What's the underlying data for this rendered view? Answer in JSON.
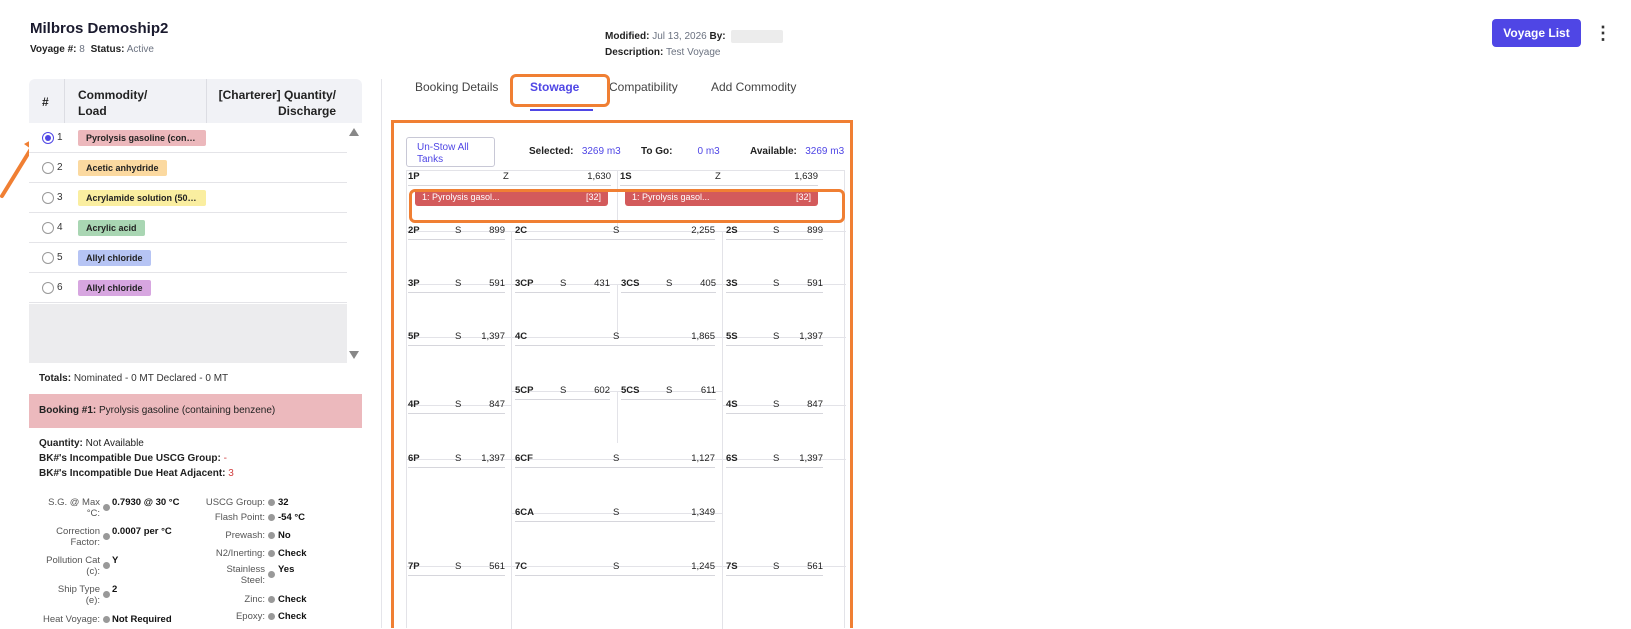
{
  "header": {
    "title": "Milbros Demoship2",
    "voyage_label": "Voyage #:",
    "voyage_value": "8",
    "status_label": "Status:",
    "status_value": "Active",
    "modified_label": "Modified:",
    "modified_value": "Jul 13, 2026",
    "by_label": "By:",
    "description_label": "Description:",
    "description_value": "Test Voyage",
    "voyage_list_button": "Voyage List",
    "more_icon": "kebab-menu-icon"
  },
  "commodity_table": {
    "col_num": "#",
    "col_commodity_1": "Commodity/",
    "col_commodity_2": "Load",
    "col_qty_1": "[Charterer] Quantity/",
    "col_qty_2": "Discharge",
    "rows": [
      {
        "num": "1",
        "name": "Pyrolysis gasoline (containi...",
        "color": "#ecb8bc",
        "selected": true
      },
      {
        "num": "2",
        "name": "Acetic anhydride",
        "color": "#fbd9a0",
        "selected": false
      },
      {
        "num": "3",
        "name": "Acrylamide solution (50% o...",
        "color": "#faeea0",
        "selected": false
      },
      {
        "num": "4",
        "name": "Acrylic acid",
        "color": "#a9d6b3",
        "selected": false
      },
      {
        "num": "5",
        "name": "Allyl chloride",
        "color": "#b6c4f4",
        "selected": false
      },
      {
        "num": "6",
        "name": "Allyl chloride",
        "color": "#d7a6e0",
        "selected": false
      }
    ]
  },
  "totals": {
    "label": "Totals:",
    "text": "Nominated - 0 MT Declared - 0 MT"
  },
  "booking": {
    "label": "Booking #1:",
    "text": "Pyrolysis gasoline (containing benzene)"
  },
  "details": {
    "quantity_label": "Quantity:",
    "quantity_value": "Not Available",
    "uscg_incompat_label": "BK#'s Incompatible Due USCG Group:",
    "uscg_incompat_value": "-",
    "heat_incompat_label": "BK#'s Incompatible Due Heat Adjacent:",
    "heat_incompat_value": "3"
  },
  "props_left": [
    {
      "k1": "S.G. @ Max",
      "k2": "°C:",
      "v": "0.7930 @ 30 °C"
    },
    {
      "k1": "Correction",
      "k2": "Factor:",
      "v": "0.0007 per °C"
    },
    {
      "k1": "Pollution Cat",
      "k2": "(c):",
      "v": "Y"
    },
    {
      "k1": "Ship Type",
      "k2": "(e):",
      "v": "2"
    },
    {
      "k1": "Heat Voyage:",
      "k2": "",
      "v": "Not Required"
    }
  ],
  "props_right": [
    {
      "k1": "USCG Group:",
      "k2": "",
      "v": "32"
    },
    {
      "k1": "Flash Point:",
      "k2": "",
      "v": "-54 °C"
    },
    {
      "k1": "Prewash:",
      "k2": "",
      "v": "No"
    },
    {
      "k1": "N2/Inerting:",
      "k2": "",
      "v": "Check"
    },
    {
      "k1": "Stainless",
      "k2": "Steel:",
      "v": "Yes"
    },
    {
      "k1": "Zinc:",
      "k2": "",
      "v": "Check"
    },
    {
      "k1": "Epoxy:",
      "k2": "",
      "v": "Check"
    }
  ],
  "tabs": [
    "Booking Details",
    "Stowage",
    "Compatibility",
    "Add Commodity"
  ],
  "stowage": {
    "unstow_label": "Un-Stow All Tanks",
    "selected_label": "Selected:",
    "selected_value": "3269 m3",
    "togo_label": "To Go:",
    "togo_value": "0 m3",
    "available_label": "Available:",
    "available_value": "3269 m3",
    "tanks": {
      "1P": {
        "name": "1P",
        "type": "Z",
        "cap": "1,630"
      },
      "1S": {
        "name": "1S",
        "type": "Z",
        "cap": "1,639"
      },
      "2P": {
        "name": "2P",
        "type": "S",
        "cap": "899"
      },
      "2C": {
        "name": "2C",
        "type": "S",
        "cap": "2,255"
      },
      "2S": {
        "name": "2S",
        "type": "S",
        "cap": "899"
      },
      "3P": {
        "name": "3P",
        "type": "S",
        "cap": "591"
      },
      "3CP": {
        "name": "3CP",
        "type": "S",
        "cap": "431"
      },
      "3CS": {
        "name": "3CS",
        "type": "S",
        "cap": "405"
      },
      "3S": {
        "name": "3S",
        "type": "S",
        "cap": "591"
      },
      "5P": {
        "name": "5P",
        "type": "S",
        "cap": "1,397"
      },
      "4C": {
        "name": "4C",
        "type": "S",
        "cap": "1,865"
      },
      "5S": {
        "name": "5S",
        "type": "S",
        "cap": "1,397"
      },
      "5CP": {
        "name": "5CP",
        "type": "S",
        "cap": "602"
      },
      "5CS": {
        "name": "5CS",
        "type": "S",
        "cap": "611"
      },
      "4P": {
        "name": "4P",
        "type": "S",
        "cap": "847"
      },
      "4S": {
        "name": "4S",
        "type": "S",
        "cap": "847"
      },
      "6P": {
        "name": "6P",
        "type": "S",
        "cap": "1,397"
      },
      "6CF": {
        "name": "6CF",
        "type": "S",
        "cap": "1,127"
      },
      "6S": {
        "name": "6S",
        "type": "S",
        "cap": "1,397"
      },
      "6CA": {
        "name": "6CA",
        "type": "S",
        "cap": "1,349"
      },
      "7P": {
        "name": "7P",
        "type": "S",
        "cap": "561"
      },
      "7C": {
        "name": "7C",
        "type": "S",
        "cap": "1,245"
      },
      "7S": {
        "name": "7S",
        "type": "S",
        "cap": "561"
      }
    },
    "assignments": {
      "1P": {
        "label": "1: Pyrolysis gasol...",
        "qty": "[32]"
      },
      "1S": {
        "label": "1: Pyrolysis gasol...",
        "qty": "[32]"
      }
    }
  }
}
